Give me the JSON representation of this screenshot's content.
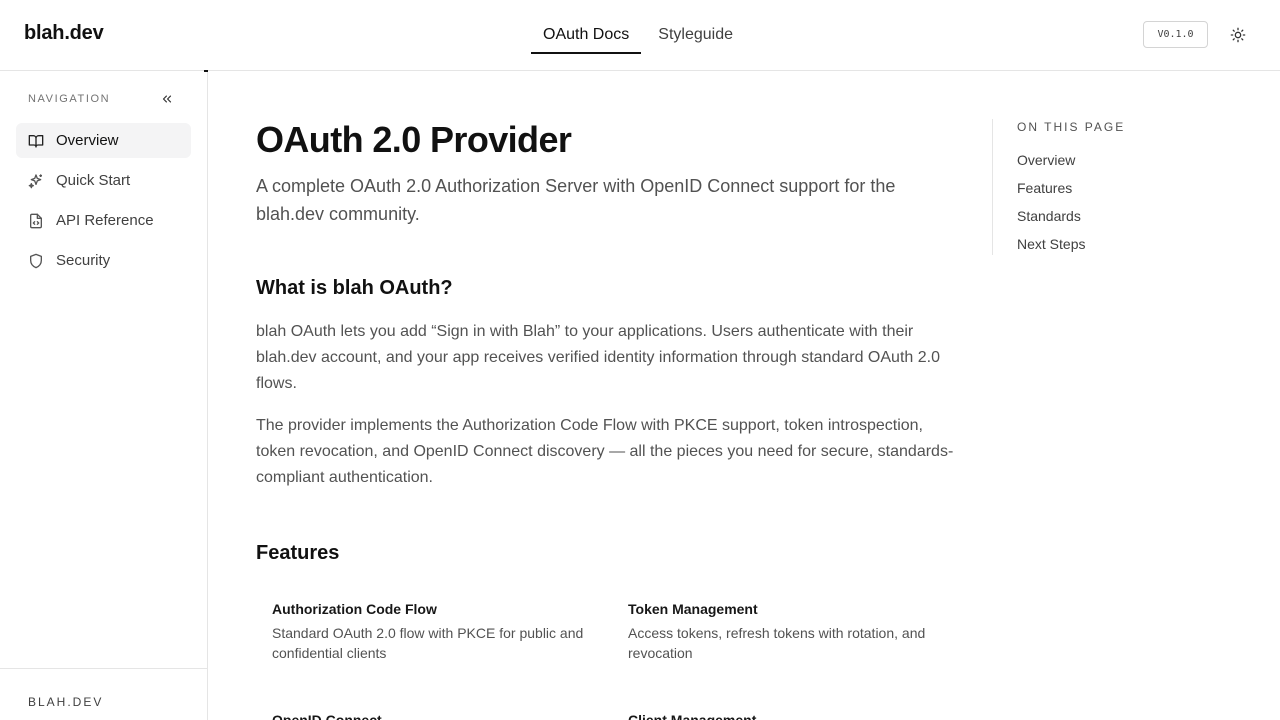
{
  "header": {
    "brand": "blah.dev",
    "tabs": [
      {
        "label": "OAuth Docs",
        "active": true
      },
      {
        "label": "Styleguide",
        "active": false
      }
    ],
    "version": "V0.1.0",
    "theme_icon": "sun-icon"
  },
  "sidebar": {
    "title": "NAVIGATION",
    "collapse_icon": "chevrons-left-icon",
    "items": [
      {
        "label": "Overview",
        "icon": "book-open-icon",
        "active": true
      },
      {
        "label": "Quick Start",
        "icon": "sparkles-icon",
        "active": false
      },
      {
        "label": "API Reference",
        "icon": "file-code-icon",
        "active": false
      },
      {
        "label": "Security",
        "icon": "shield-icon",
        "active": false
      }
    ],
    "footer": "BLAH.DEV"
  },
  "main": {
    "title": "OAuth 2.0 Provider",
    "lead": "A complete OAuth 2.0 Authorization Server with OpenID Connect support for the blah.dev community.",
    "what_heading": "What is blah OAuth?",
    "what_p1": "blah OAuth lets you add “Sign in with Blah” to your applications. Users authenticate with their blah.dev account, and your app receives verified identity information through standard OAuth 2.0 flows.",
    "what_p2": "The provider implements the Authorization Code Flow with PKCE support, token introspection, token revocation, and OpenID Connect discovery — all the pieces you need for secure, standards-compliant authentication.",
    "features_heading": "Features",
    "features": [
      {
        "title": "Authorization Code Flow",
        "desc": "Standard OAuth 2.0 flow with PKCE for public and confidential clients"
      },
      {
        "title": "Token Management",
        "desc": "Access tokens, refresh tokens with rotation, and revocation"
      },
      {
        "title": "OpenID Connect",
        "desc": ""
      },
      {
        "title": "Client Management",
        "desc": ""
      }
    ]
  },
  "toc": {
    "title": "ON THIS PAGE",
    "links": [
      "Overview",
      "Features",
      "Standards",
      "Next Steps"
    ]
  },
  "colors": {
    "text": "#171717",
    "muted": "#525252",
    "border": "#e5e5e5",
    "active_bg": "#f4f4f5"
  }
}
